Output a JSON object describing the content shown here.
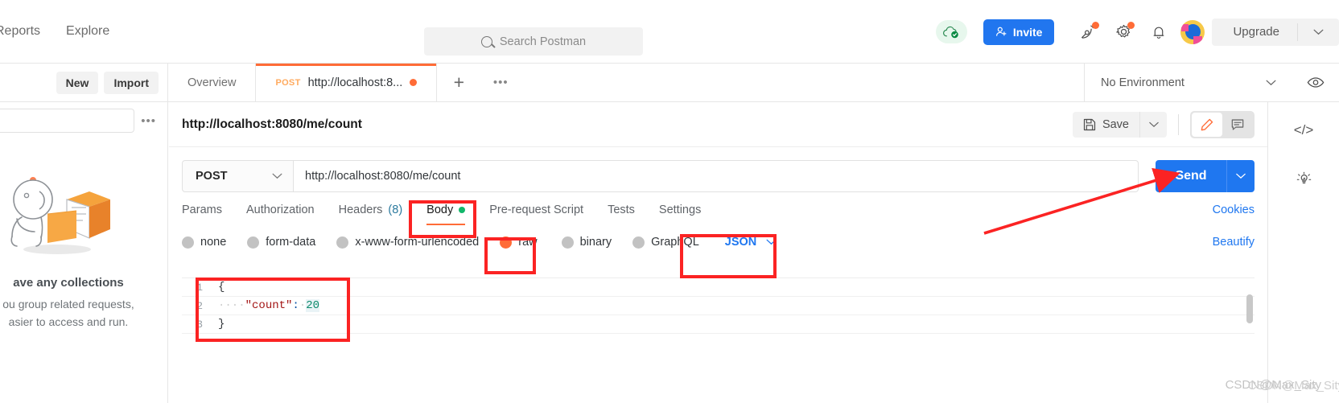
{
  "header": {
    "nav": [
      {
        "label": "Reports"
      },
      {
        "label": "Explore"
      }
    ],
    "search": {
      "placeholder": "Search Postman",
      "icon": "search-icon"
    },
    "cloud_status_icon": "cloud-check-icon",
    "invite_label": "Invite",
    "icons": [
      {
        "name": "satellite-icon",
        "badge": true
      },
      {
        "name": "gear-icon",
        "badge": true
      },
      {
        "name": "bell-icon",
        "badge": false
      }
    ],
    "avatar_label": "user-avatar",
    "upgrade_label": "Upgrade"
  },
  "workbench": {
    "new_label": "New",
    "import_label": "Import",
    "tabs": [
      {
        "label": "Overview",
        "active": false,
        "method": "",
        "dirty": false
      },
      {
        "label": "http://localhost:8...",
        "active": true,
        "method": "POST",
        "dirty": true
      }
    ],
    "add_tab_icon": "plus-icon",
    "tab_options_icon": "ellipsis-icon",
    "environment": "No Environment",
    "env_chevron_icon": "chevron-down-icon",
    "env_eye_icon": "eye-icon"
  },
  "sidebar": {
    "search_placeholder": "",
    "more_icon": "ellipsis-icon",
    "illustration": "person-with-box-illustration",
    "empty_title": "ave any collections",
    "empty_line1": "ou group related requests,",
    "empty_line2": "asier to access and run."
  },
  "request": {
    "title": "http://localhost:8080/me/count",
    "save_label": "Save",
    "save_icon": "floppy-disk-icon",
    "save_caret_icon": "chevron-down-icon",
    "edit_icon": "pencil-icon",
    "comment_icon": "comment-icon",
    "method": "POST",
    "method_caret_icon": "chevron-down-icon",
    "url": "http://localhost:8080/me/count",
    "send_label": "Send",
    "send_caret_icon": "chevron-down-icon",
    "tabs": [
      {
        "label": "Params",
        "active": false
      },
      {
        "label": "Authorization",
        "active": false
      },
      {
        "label": "Headers",
        "count": "(8)",
        "active": false
      },
      {
        "label": "Body",
        "active": true,
        "dot": true
      },
      {
        "label": "Pre-request Script",
        "active": false
      },
      {
        "label": "Tests",
        "active": false
      },
      {
        "label": "Settings",
        "active": false
      }
    ],
    "cookies_label": "Cookies",
    "body_types": [
      {
        "label": "none",
        "selected": false
      },
      {
        "label": "form-data",
        "selected": false
      },
      {
        "label": "x-www-form-urlencoded",
        "selected": false
      },
      {
        "label": "raw",
        "selected": true
      },
      {
        "label": "binary",
        "selected": false
      },
      {
        "label": "GraphQL",
        "selected": false
      }
    ],
    "format": "JSON",
    "format_caret_icon": "chevron-down-icon",
    "beautify_label": "Beautify",
    "code": [
      {
        "num": "1",
        "indent": "",
        "content": "{",
        "type": "brace"
      },
      {
        "num": "2",
        "indent": "····",
        "key": "\"count\"",
        "colon": ":",
        "value": "20"
      },
      {
        "num": "3",
        "indent": "",
        "content": "}",
        "type": "brace"
      }
    ]
  },
  "right_rail": {
    "items": [
      {
        "name": "code-snippet-icon",
        "glyph": "</>"
      },
      {
        "name": "lightbulb-icon",
        "glyph": ""
      }
    ]
  },
  "watermark": {
    "text1": "CSDN@Max_Sity",
    "text2": "CSDN@Max_Sity"
  },
  "colors": {
    "accent_orange": "#ff6c37",
    "accent_blue": "#1f77f0",
    "annotation_red": "#fb2323",
    "green_dot": "#12b76a"
  }
}
